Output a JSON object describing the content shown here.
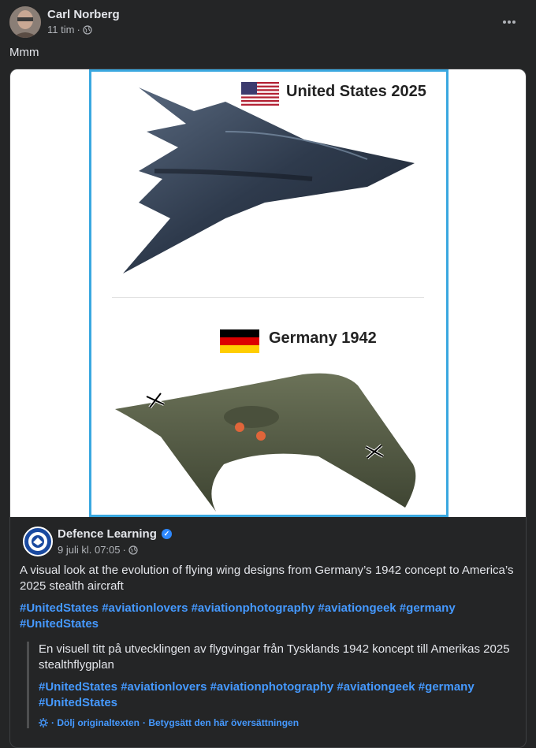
{
  "post": {
    "author": "Carl Norberg",
    "time": "11 tim",
    "separator": "·",
    "text": "Mmm"
  },
  "image": {
    "label_top": "United States 2025",
    "label_bottom": "Germany 1942"
  },
  "shared_page": {
    "name": "Defence Learning",
    "date": "9 juli kl. 07:05",
    "separator": "·",
    "description": "A visual look at the evolution of flying wing designs from Germany’s 1942 concept to America’s 2025 stealth aircraft",
    "hashtags": "#UnitedStates #aviationlovers #aviationphotography #aviationgeek #germany #UnitedStates"
  },
  "translation": {
    "text": "En visuell titt på utvecklingen av flygvingar från Tysklands 1942 koncept till Amerikas 2025 stealthflygplan",
    "hashtags": "#UnitedStates #aviationlovers #aviationphotography #aviationgeek #germany #UnitedStates",
    "hide_original": "· Dölj originaltexten",
    "rate": "· Betygsätt den här översättningen"
  },
  "colors": {
    "background": "#242526",
    "link": "#4599ff",
    "frame": "#3aa8e0"
  }
}
